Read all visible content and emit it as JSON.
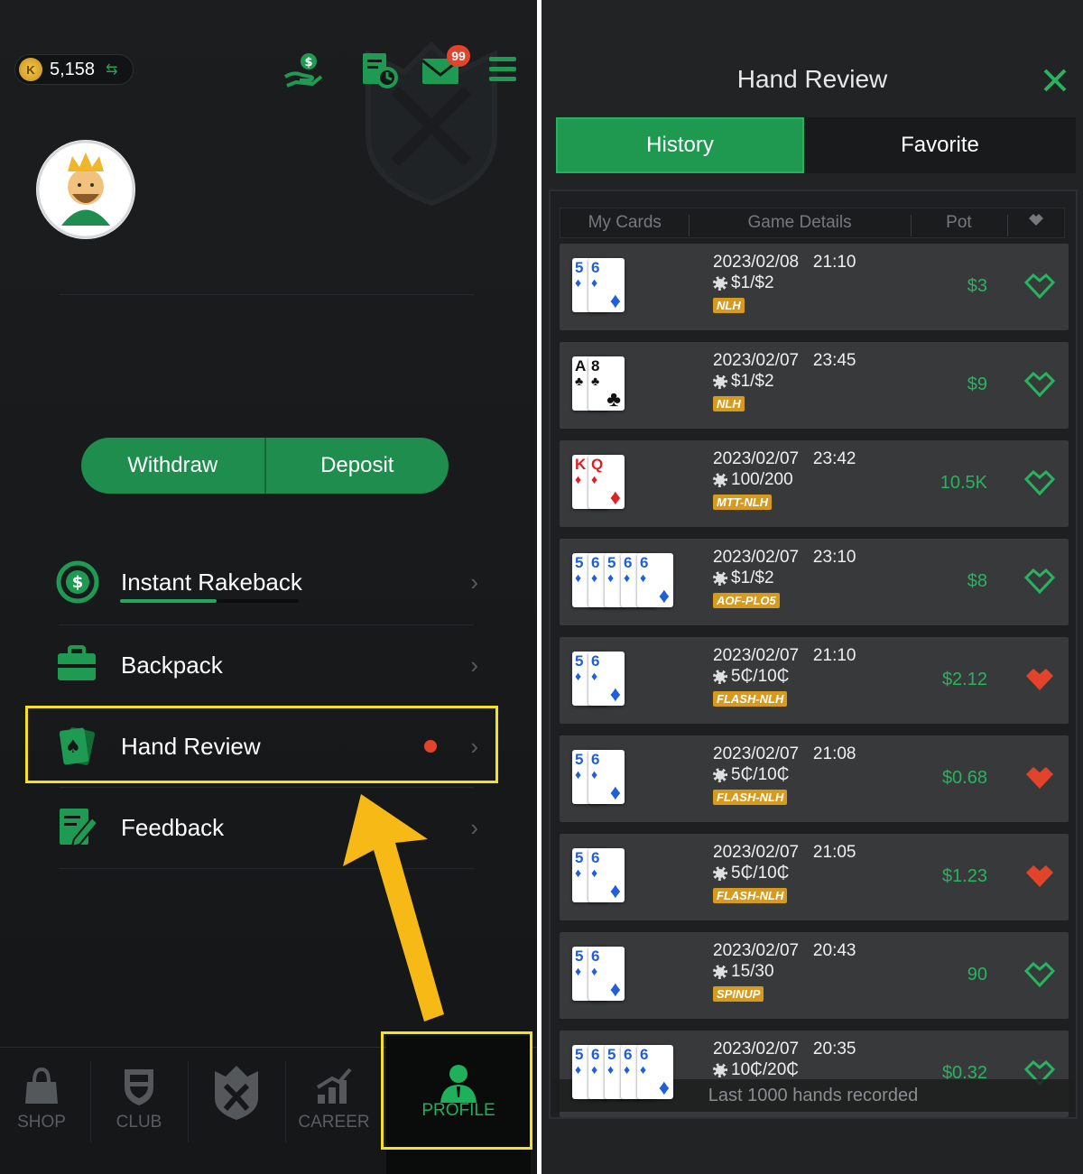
{
  "left": {
    "coins": {
      "value": "5,158",
      "currency_letter": "K"
    },
    "notification_badge": "99",
    "buttons": {
      "withdraw": "Withdraw",
      "deposit": "Deposit"
    },
    "menu": [
      {
        "label": "Instant Rakeback",
        "icon": "rakeback-dollar-icon",
        "progress_percent": 54
      },
      {
        "label": "Backpack",
        "icon": "briefcase-icon"
      },
      {
        "label": "Hand Review",
        "icon": "cards-icon",
        "has_new_dot": true
      },
      {
        "label": "Feedback",
        "icon": "edit-note-icon"
      }
    ],
    "nav": [
      {
        "label": "SHOP",
        "icon": "shopping-bag-icon"
      },
      {
        "label": "CLUB",
        "icon": "shield-icon"
      },
      {
        "label": "",
        "icon": "emblem-icon"
      },
      {
        "label": "CAREER",
        "icon": "chart-bars-icon"
      },
      {
        "label": "PROFILE",
        "icon": "user-icon",
        "active": true
      }
    ],
    "colors": {
      "accent": "#1f8d4d",
      "highlight": "#f6e024",
      "arrow": "#f6b916"
    }
  },
  "right": {
    "title": "Hand Review",
    "tabs": {
      "history": "History",
      "favorite": "Favorite"
    },
    "columns": {
      "my_cards": "My Cards",
      "game_details": "Game Details",
      "pot": "Pot"
    },
    "hands": [
      {
        "cards": [
          "5♦",
          "6♦"
        ],
        "date": "2023/02/08   21:10",
        "stakes": "$1/$2",
        "tag": "NLH",
        "pot": "$3",
        "favorited": false
      },
      {
        "cards": [
          "A♣",
          "8♣"
        ],
        "date": "2023/02/07   23:45",
        "stakes": "$1/$2",
        "tag": "NLH",
        "pot": "$9",
        "favorited": false
      },
      {
        "cards": [
          "K♦",
          "Q♦"
        ],
        "date": "2023/02/07   23:42",
        "stakes": "100/200",
        "tag": "MTT-NLH",
        "pot": "10.5K",
        "favorited": false
      },
      {
        "cards": [
          "5♦",
          "6♦",
          "5♦",
          "6♦",
          "6♦"
        ],
        "date": "2023/02/07   23:10",
        "stakes": "$1/$2",
        "tag": "AOF-PLO5",
        "pot": "$8",
        "favorited": false
      },
      {
        "cards": [
          "5♦",
          "6♦"
        ],
        "date": "2023/02/07   21:10",
        "stakes": "5₵/10₵",
        "tag": "FLASH-NLH",
        "pot": "$2.12",
        "favorited": true
      },
      {
        "cards": [
          "5♦",
          "6♦"
        ],
        "date": "2023/02/07   21:08",
        "stakes": "5₵/10₵",
        "tag": "FLASH-NLH",
        "pot": "$0.68",
        "favorited": true
      },
      {
        "cards": [
          "5♦",
          "6♦"
        ],
        "date": "2023/02/07   21:05",
        "stakes": "5₵/10₵",
        "tag": "FLASH-NLH",
        "pot": "$1.23",
        "favorited": true
      },
      {
        "cards": [
          "5♦",
          "6♦"
        ],
        "date": "2023/02/07   20:43",
        "stakes": "15/30",
        "tag": "SPINUP",
        "pot": "90",
        "favorited": false
      },
      {
        "cards": [
          "5♦",
          "6♦",
          "5♦",
          "6♦",
          "6♦"
        ],
        "date": "2023/02/07   20:35",
        "stakes": "10₵/20₵",
        "tag": "",
        "pot": "$0.32",
        "favorited": false
      }
    ],
    "footer_note": "Last 1000 hands recorded",
    "colors": {
      "tab_active": "#1f9850",
      "pot": "#28b45f",
      "fav_on": "#e2432b",
      "fav_off": "#28b45f",
      "tag": "#d69a1f"
    }
  }
}
